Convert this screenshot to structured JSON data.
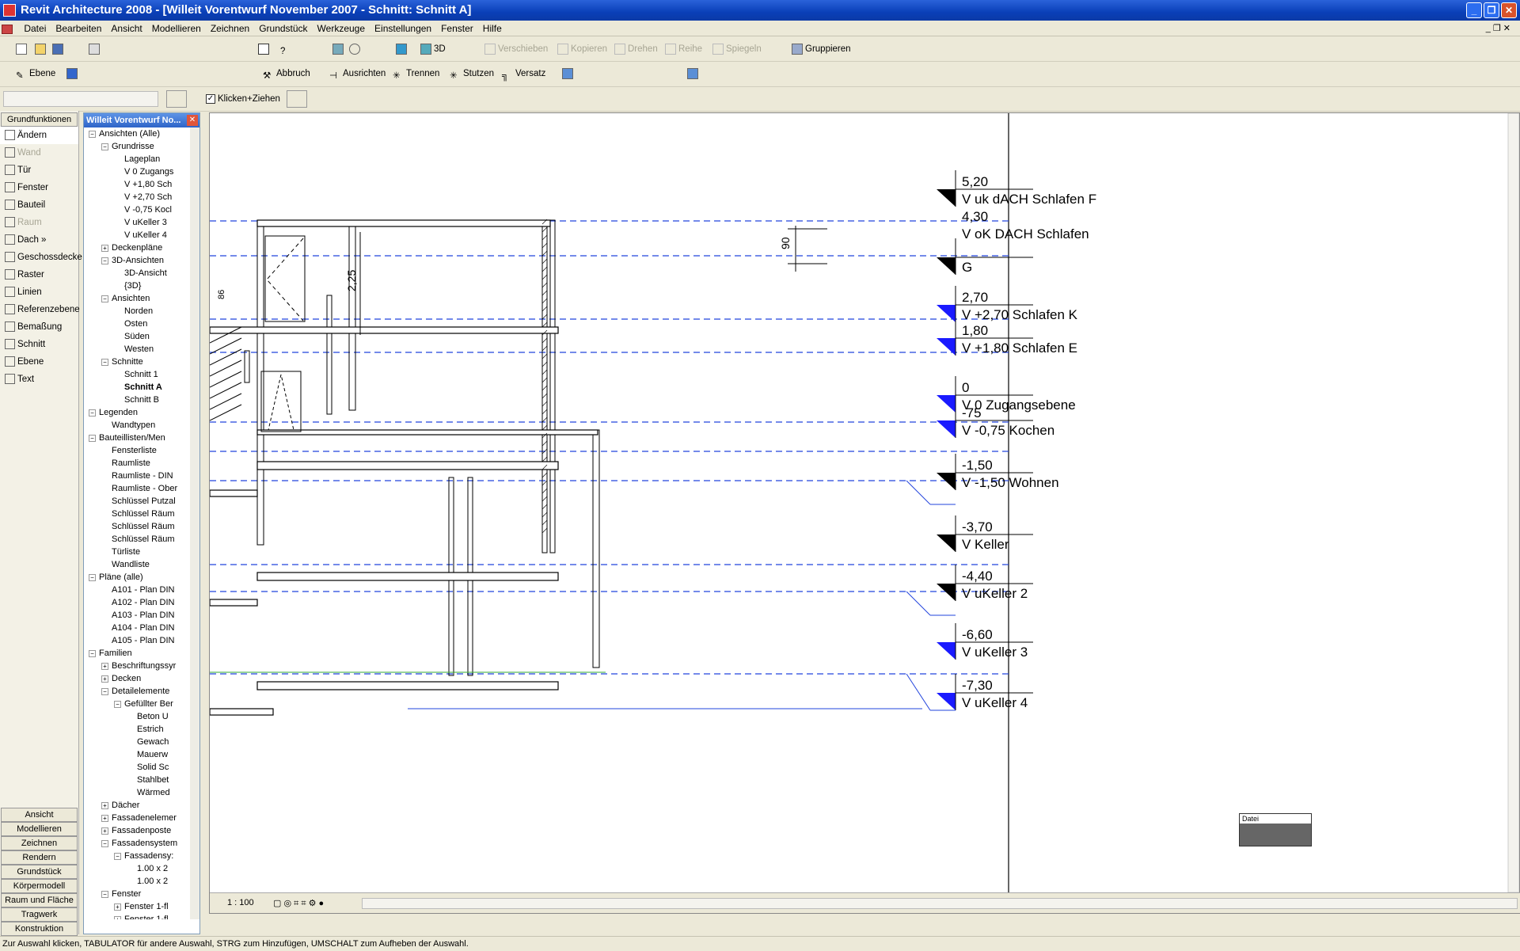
{
  "app": {
    "title": "Revit Architecture 2008 - [Willeit Vorentwurf November 2007 - Schnitt: Schnitt A]"
  },
  "menu": [
    "Datei",
    "Bearbeiten",
    "Ansicht",
    "Modellieren",
    "Zeichnen",
    "Grundstück",
    "Werkzeuge",
    "Einstellungen",
    "Fenster",
    "Hilfe"
  ],
  "toolbar1": {
    "threed": "3D",
    "verschieben": "Verschieben",
    "kopieren": "Kopieren",
    "drehen": "Drehen",
    "reihe": "Reihe",
    "spiegeln": "Spiegeln",
    "gruppieren": "Gruppieren"
  },
  "toolbar2": {
    "ebene": "Ebene",
    "abbruch": "Abbruch",
    "ausrichten": "Ausrichten",
    "trennen": "Trennen",
    "stutzen": "Stutzen",
    "versatz": "Versatz"
  },
  "options": {
    "klicken": "Klicken+Ziehen"
  },
  "designbar": {
    "header": "Grundfunktionen",
    "items": [
      "Ändern",
      "Wand",
      "Tür",
      "Fenster",
      "Bauteil",
      "Raum",
      "Dach »",
      "Geschossdecke",
      "Raster",
      "Linien",
      "Referenzebene",
      "Bemaßung",
      "Schnitt",
      "Ebene",
      "Text"
    ],
    "categories": [
      "Ansicht",
      "Modellieren",
      "Zeichnen",
      "Rendern",
      "Grundstück",
      "Körpermodell",
      "Raum und Fläche",
      "Tragwerk",
      "Konstruktion"
    ]
  },
  "browser": {
    "title": "Willeit Vorentwurf No...",
    "nodes": [
      "Ansichten (Alle)",
      "Grundrisse",
      "Lageplan",
      "V 0 Zugangs",
      "V +1,80 Sch",
      "V +2,70 Sch",
      "V -0,75 Kocl",
      "V uKeller 3",
      "V uKeller 4",
      "Deckenpläne",
      "3D-Ansichten",
      "3D-Ansicht",
      "{3D}",
      "Ansichten",
      "Norden",
      "Osten",
      "Süden",
      "Westen",
      "Schnitte",
      "Schnitt 1",
      "Schnitt A",
      "Schnitt B",
      "Legenden",
      "Wandtypen",
      "Bauteillisten/Men",
      "Fensterliste",
      "Raumliste",
      "Raumliste - DIN",
      "Raumliste - Ober",
      "Schlüssel Putzal",
      "Schlüssel Räum",
      "Schlüssel Räum",
      "Schlüssel Räum",
      "Türliste",
      "Wandliste",
      "Pläne (alle)",
      "A101 - Plan DIN",
      "A102 - Plan DIN",
      "A103 - Plan DIN",
      "A104 - Plan DIN",
      "A105 - Plan DIN",
      "Familien",
      "Beschriftungssyr",
      "Decken",
      "Detailelemente",
      "Gefüllter Ber",
      "Beton U",
      "Estrich",
      "Gewach",
      "Mauerw",
      "Solid Sc",
      "Stahlbet",
      "Wärmed",
      "Dächer",
      "Fassadenelemer",
      "Fassadenposte",
      "Fassadensystem",
      "Fassadensy:",
      "1.00 x 2",
      "1.00 x 2",
      "Fenster",
      "Fenster 1-fl",
      "Fenster 1-fl"
    ]
  },
  "levels": [
    {
      "elev": "5,20",
      "name": "V uk dACH Schlafen F"
    },
    {
      "elev": "4,30",
      "name": "V oK DACH Schlafen"
    },
    {
      "elev": "",
      "name": "G"
    },
    {
      "elev": "2,70",
      "name": "V +2,70 Schlafen K"
    },
    {
      "elev": "1,80",
      "name": "V +1,80 Schlafen E"
    },
    {
      "elev": "0",
      "name": "V 0 Zugangsebene"
    },
    {
      "elev": "-75",
      "name": "V -0,75 Kochen"
    },
    {
      "elev": "-1,50",
      "name": "V -1,50 Wohnen"
    },
    {
      "elev": "-3,70",
      "name": "V Keller"
    },
    {
      "elev": "-4,40",
      "name": "V uKeller 2"
    },
    {
      "elev": "-6,60",
      "name": "V uKeller 3"
    },
    {
      "elev": "-7,30",
      "name": "V uKeller 4"
    }
  ],
  "dims": {
    "d90": "90",
    "d225": "2,25",
    "d86": "86"
  },
  "popup": {
    "label": "Datei"
  },
  "viewcontrol": {
    "scale": "1 : 100"
  },
  "status": {
    "text": "Zur Auswahl klicken, TABULATOR für andere Auswahl, STRG zum Hinzufügen, UMSCHALT zum Aufheben der Auswahl."
  }
}
